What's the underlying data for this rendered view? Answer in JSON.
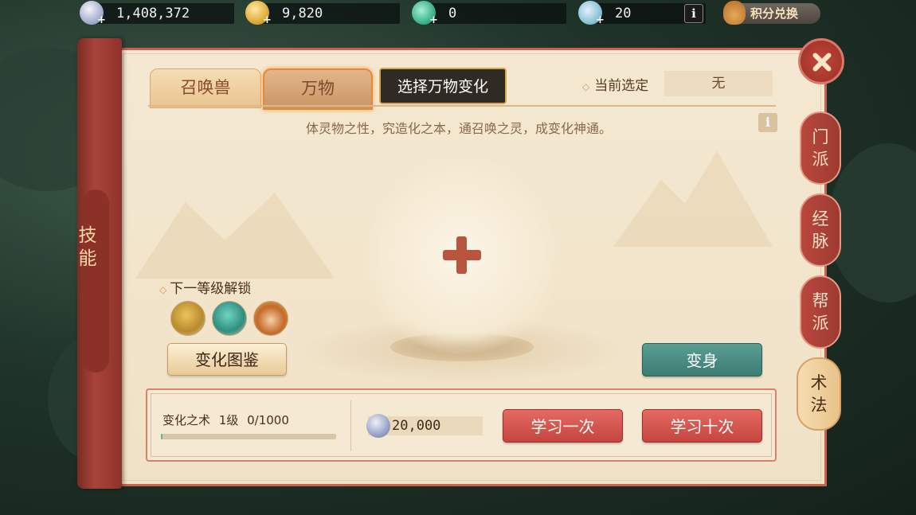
{
  "resources": [
    {
      "icon": "silver-coin-icon",
      "value": "1,408,372",
      "color": "#b8bfd9"
    },
    {
      "icon": "gold-coin-icon",
      "value": "9,820",
      "color": "#e6b94a"
    },
    {
      "icon": "jade-icon",
      "value": "0",
      "color": "#55c6a3"
    },
    {
      "icon": "cloud-icon",
      "value": "20",
      "color": "#8fc3d6"
    }
  ],
  "topbar": {
    "info_label": "i",
    "exchange_label": "积分兑换"
  },
  "left_scroll": {
    "label": "技能"
  },
  "tabs": {
    "summon": "召唤兽",
    "things": "万物",
    "select_button": "选择万物变化"
  },
  "current": {
    "label": "当前选定",
    "value": "无"
  },
  "description": "体灵物之性，究造化之本，通召唤之灵，成变化神通。",
  "info_label": "i",
  "unlock": {
    "label": "下一等级解锁"
  },
  "buttons": {
    "gallery": "变化图鉴",
    "transform": "变身",
    "learn_once": "学习一次",
    "learn_ten": "学习十次"
  },
  "skill": {
    "name": "变化之术",
    "level": "1级",
    "progress_text": "0/1000",
    "progress": 0.01
  },
  "cost": {
    "value": "20,000"
  },
  "side_tabs": [
    "门派",
    "经脉",
    "帮派",
    "术法"
  ],
  "colors": {
    "accent_red": "#c5453e",
    "accent_teal": "#3b7c73",
    "panel": "#f4e8d2"
  }
}
